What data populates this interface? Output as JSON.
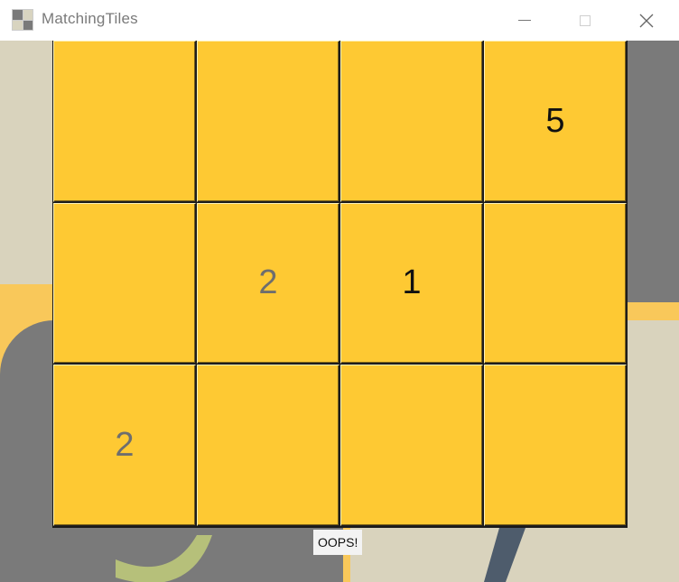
{
  "window": {
    "title": "MatchingTiles",
    "controls": {
      "minimize": "minimize",
      "maximize": "maximize",
      "close": "close"
    }
  },
  "icons": {
    "app": "app-icon",
    "minimize": "minimize-icon",
    "maximize": "maximize-icon",
    "close": "close-icon"
  },
  "colors": {
    "tile": "#fec933",
    "tile_text_revealed": "#111111",
    "tile_text_dim": "#6e6e6e",
    "background_orange": "#f9c85a",
    "background_gray": "#7a7a7a",
    "background_beige": "#d9d3bd"
  },
  "board": {
    "rows": 3,
    "columns": 4,
    "tiles": [
      {
        "label": "",
        "state": "hidden"
      },
      {
        "label": "",
        "state": "hidden"
      },
      {
        "label": "",
        "state": "hidden"
      },
      {
        "label": "5",
        "state": "revealed"
      },
      {
        "label": "",
        "state": "hidden"
      },
      {
        "label": "2",
        "state": "dim"
      },
      {
        "label": "1",
        "state": "revealed"
      },
      {
        "label": "",
        "state": "hidden"
      },
      {
        "label": "2",
        "state": "dim"
      },
      {
        "label": "",
        "state": "hidden"
      },
      {
        "label": "",
        "state": "hidden"
      },
      {
        "label": "",
        "state": "hidden"
      }
    ]
  },
  "status": {
    "message": "OOPS!"
  }
}
